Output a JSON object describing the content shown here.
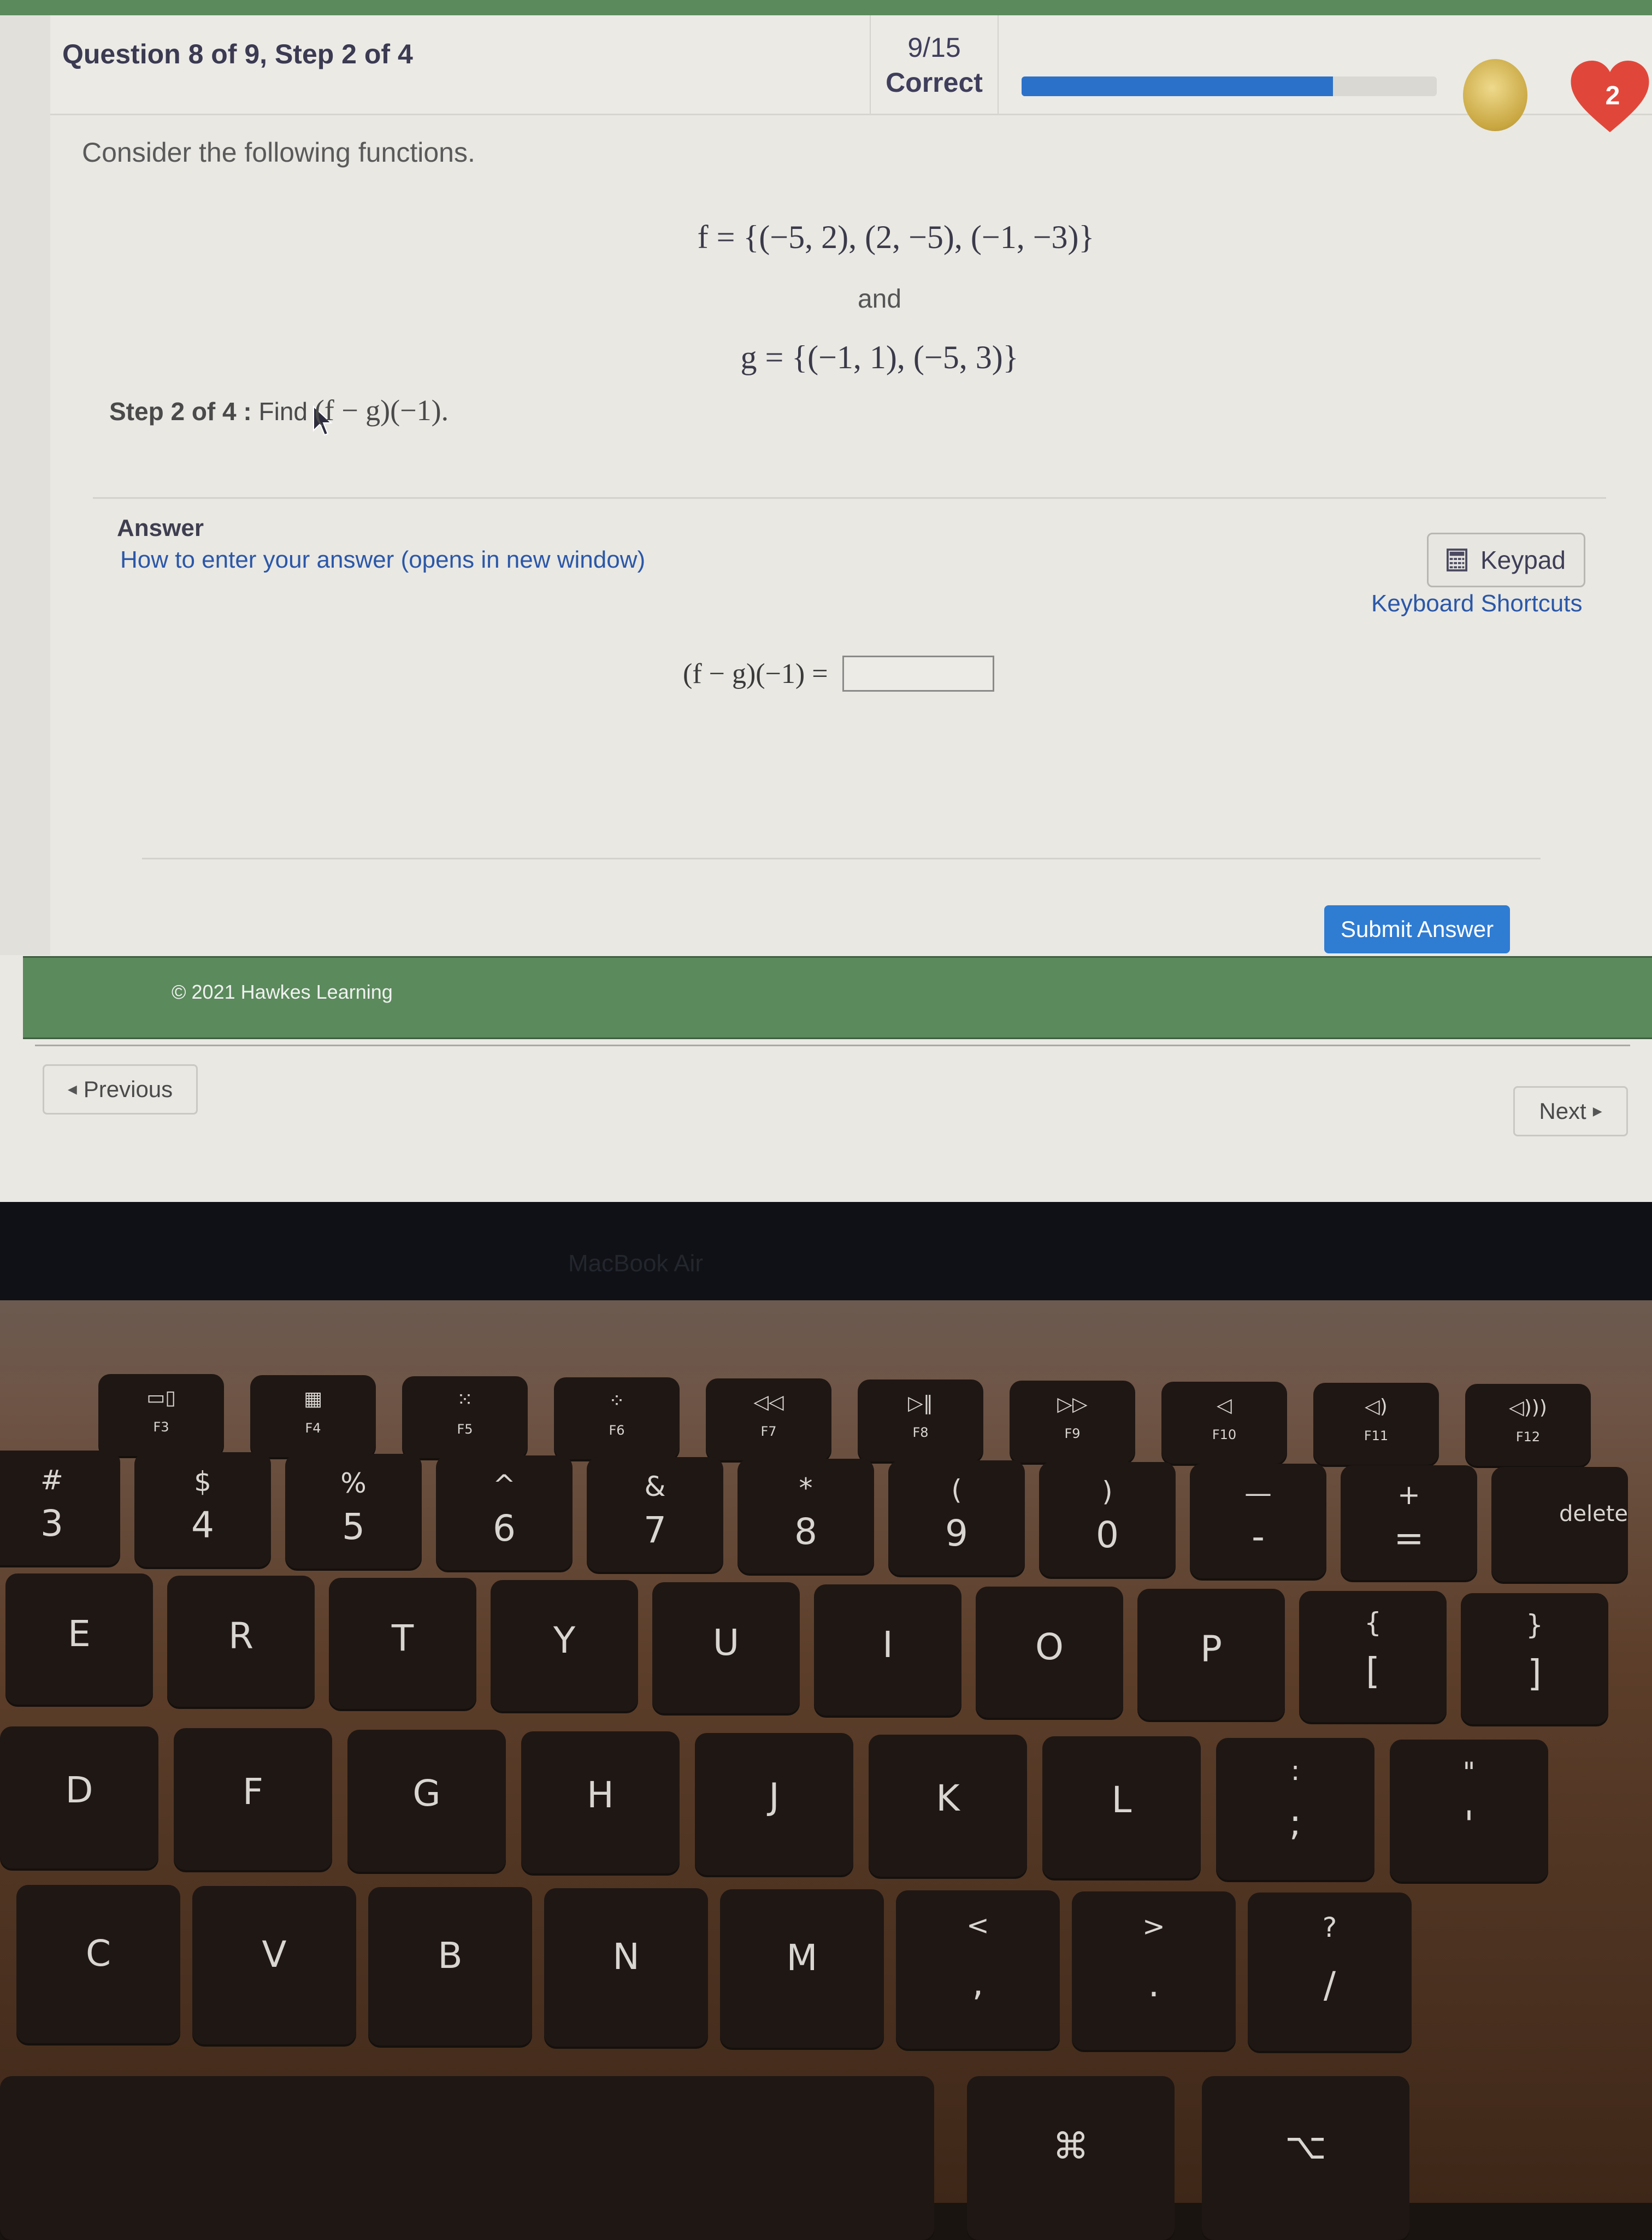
{
  "header": {
    "question_title": "Question 8 of 9, Step 2 of 4",
    "score_fraction": "9/15",
    "score_label": "Correct",
    "progress_percent": 75,
    "coin_icon": "coin-icon",
    "lives_icon": "heart-icon",
    "lives_count": "2",
    "colors": {
      "progress": "#2c71c9",
      "heart": "#e0473a",
      "green_bar": "#5b8a5c"
    }
  },
  "problem": {
    "intro": "Consider the following functions.",
    "f_def": "f = {(−5, 2), (2, −5), (−1, −3)}",
    "connector": "and",
    "g_def": "g = {(−1, 1), (−5, 3)}",
    "step_label": "Step 2 of 4 :",
    "step_text": "Find ",
    "step_math": "(f − g)(−1)."
  },
  "answer": {
    "title": "Answer",
    "howto_link": "How to enter your answer (opens in new window)",
    "keypad_label": "Keypad",
    "keypad_icon": "calculator-icon",
    "shortcuts_link": "Keyboard Shortcuts",
    "equation_lhs": "(f − g)(−1) =",
    "input_value": "",
    "submit_label": "Submit Answer"
  },
  "footer": {
    "copyright": "© 2021 Hawkes Learning",
    "previous_label": "Previous",
    "next_label": "Next"
  },
  "laptop": {
    "brand": "MacBook Air",
    "fn_row": [
      {
        "label": "F3",
        "icon": "▭▯"
      },
      {
        "label": "F4",
        "icon": "▦"
      },
      {
        "label": "F5",
        "icon": "⁙"
      },
      {
        "label": "F6",
        "icon": "⁘"
      },
      {
        "label": "F7",
        "icon": "◁◁"
      },
      {
        "label": "F8",
        "icon": "▷‖"
      },
      {
        "label": "F9",
        "icon": "▷▷"
      },
      {
        "label": "F10",
        "icon": "◁"
      },
      {
        "label": "F11",
        "icon": "◁)"
      },
      {
        "label": "F12",
        "icon": "◁)))"
      }
    ],
    "number_row": [
      {
        "main": "3",
        "sub": "#"
      },
      {
        "main": "4",
        "sub": "$"
      },
      {
        "main": "5",
        "sub": "%"
      },
      {
        "main": "6",
        "sub": "^"
      },
      {
        "main": "7",
        "sub": "&"
      },
      {
        "main": "8",
        "sub": "*"
      },
      {
        "main": "9",
        "sub": "("
      },
      {
        "main": "0",
        "sub": ")"
      },
      {
        "main": "-",
        "sub": "—"
      },
      {
        "main": "=",
        "sub": "+"
      },
      {
        "main": "delete",
        "sub": ""
      }
    ],
    "top_row": [
      {
        "main": "E"
      },
      {
        "main": "R"
      },
      {
        "main": "T"
      },
      {
        "main": "Y"
      },
      {
        "main": "U"
      },
      {
        "main": "I"
      },
      {
        "main": "O"
      },
      {
        "main": "P"
      },
      {
        "main": "[",
        "sub": "{"
      },
      {
        "main": "]",
        "sub": "}"
      }
    ],
    "home_row": [
      {
        "main": "D"
      },
      {
        "main": "F"
      },
      {
        "main": "G"
      },
      {
        "main": "H"
      },
      {
        "main": "J"
      },
      {
        "main": "K"
      },
      {
        "main": "L"
      },
      {
        "main": ";",
        "sub": ":"
      },
      {
        "main": "'",
        "sub": "\""
      }
    ],
    "bottom_row": [
      {
        "main": "C"
      },
      {
        "main": "V"
      },
      {
        "main": "B"
      },
      {
        "main": "N"
      },
      {
        "main": "M"
      },
      {
        "main": ",",
        "sub": "<"
      },
      {
        "main": ".",
        "sub": ">"
      },
      {
        "main": "/",
        "sub": "?"
      }
    ],
    "modifier_row": [
      {
        "main": "⌘"
      },
      {
        "main": "⌥"
      }
    ]
  }
}
